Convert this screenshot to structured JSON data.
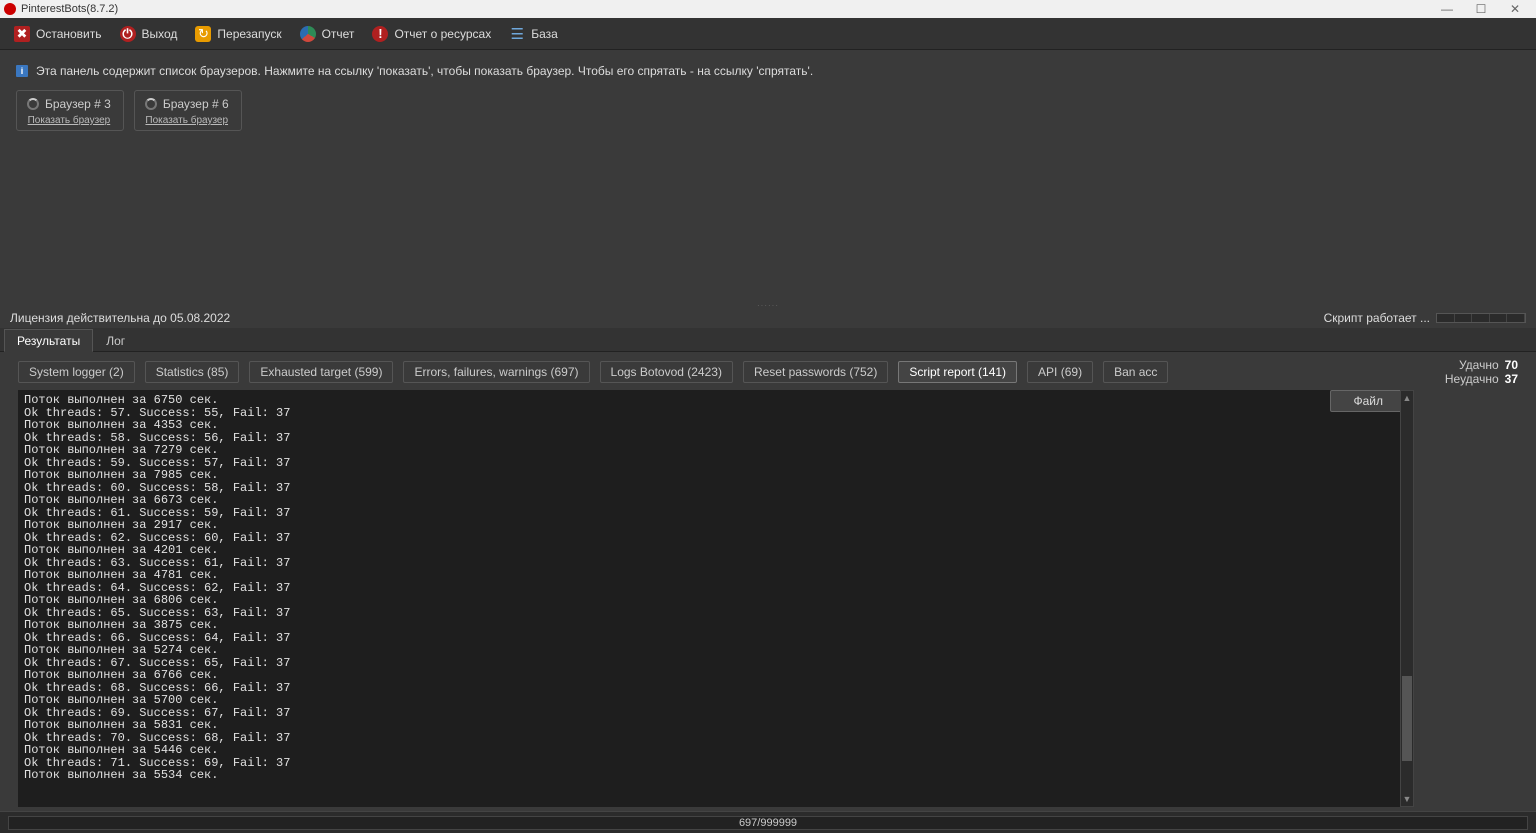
{
  "window": {
    "title": "PinterestBots(8.7.2)"
  },
  "toolbar": {
    "stop": "Остановить",
    "exit": "Выход",
    "restart": "Перезапуск",
    "report": "Отчет",
    "resource_report": "Отчет о ресурсах",
    "database": "База"
  },
  "info_panel": "Эта панель содержит список браузеров. Нажмите на ссылку 'показать', чтобы показать браузер. Чтобы его спрятать - на ссылку 'спрятать'.",
  "browsers": [
    {
      "title": "Браузер # 3",
      "show_link": "Показать браузер"
    },
    {
      "title": "Браузер # 6",
      "show_link": "Показать браузер"
    }
  ],
  "license_status": "Лицензия действительна до 05.08.2022",
  "script_status": "Скрипт работает ...",
  "main_tabs": {
    "results": "Результаты",
    "log": "Лог"
  },
  "sub_tabs": [
    "System logger (2)",
    "Statistics (85)",
    "Exhausted target (599)",
    "Errors, failures, warnings (697)",
    "Logs Botovod (2423)",
    "Reset passwords (752)",
    "Script report (141)",
    "API (69)",
    "Ban acc"
  ],
  "active_sub_tab": 6,
  "stats": {
    "success_label": "Удачно",
    "success_value": "70",
    "fail_label": "Неудачно",
    "fail_value": "37"
  },
  "file_button": "Файл",
  "log_lines": "Поток выполнен за 6750 сек.\nOk threads: 57. Success: 55, Fail: 37\nПоток выполнен за 4353 сек.\nOk threads: 58. Success: 56, Fail: 37\nПоток выполнен за 7279 сек.\nOk threads: 59. Success: 57, Fail: 37\nПоток выполнен за 7985 сек.\nOk threads: 60. Success: 58, Fail: 37\nПоток выполнен за 6673 сек.\nOk threads: 61. Success: 59, Fail: 37\nПоток выполнен за 2917 сек.\nOk threads: 62. Success: 60, Fail: 37\nПоток выполнен за 4201 сек.\nOk threads: 63. Success: 61, Fail: 37\nПоток выполнен за 4781 сек.\nOk threads: 64. Success: 62, Fail: 37\nПоток выполнен за 6806 сек.\nOk threads: 65. Success: 63, Fail: 37\nПоток выполнен за 3875 сек.\nOk threads: 66. Success: 64, Fail: 37\nПоток выполнен за 5274 сек.\nOk threads: 67. Success: 65, Fail: 37\nПоток выполнен за 6766 сек.\nOk threads: 68. Success: 66, Fail: 37\nПоток выполнен за 5700 сек.\nOk threads: 69. Success: 67, Fail: 37\nПоток выполнен за 5831 сек.\nOk threads: 70. Success: 68, Fail: 37\nПоток выполнен за 5446 сек.\nOk threads: 71. Success: 69, Fail: 37\nПоток выполнен за 5534 сек.",
  "footer_progress": "697/999999"
}
